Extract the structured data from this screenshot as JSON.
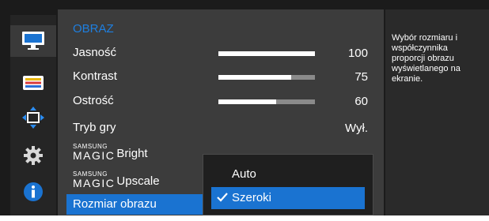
{
  "menu": {
    "title": "OBRAZ",
    "rows": [
      {
        "label": "Jasność",
        "value": "100",
        "bar_fraction": 1.0
      },
      {
        "label": "Kontrast",
        "value": "75",
        "bar_fraction": 0.75
      },
      {
        "label": "Ostrość",
        "value": "60",
        "bar_fraction": 0.6
      },
      {
        "label": "Tryb gry",
        "value": "Wył."
      }
    ],
    "magic_bright": {
      "brand_top": "SAMSUNG",
      "brand_bottom": "MAGIC",
      "word": "Bright"
    },
    "magic_upscale": {
      "brand_top": "SAMSUNG",
      "brand_bottom": "MAGIC",
      "word": "Upscale"
    },
    "selected_row": "Rozmiar obrazu"
  },
  "submenu": {
    "options": [
      "Auto",
      "Szeroki"
    ],
    "selected": "Szeroki"
  },
  "help": {
    "text": "Wybór rozmiaru i współczynnika proporcji obrazu wyświetlanego na ekranie."
  },
  "sidebar": {
    "icons": [
      "monitor-icon",
      "color-bars-icon",
      "resize-icon",
      "gear-icon",
      "info-icon"
    ],
    "active": "monitor-icon"
  },
  "colors": {
    "accent": "#1a73d1",
    "title": "#1e7fe0",
    "background": "#1b1b1b"
  }
}
